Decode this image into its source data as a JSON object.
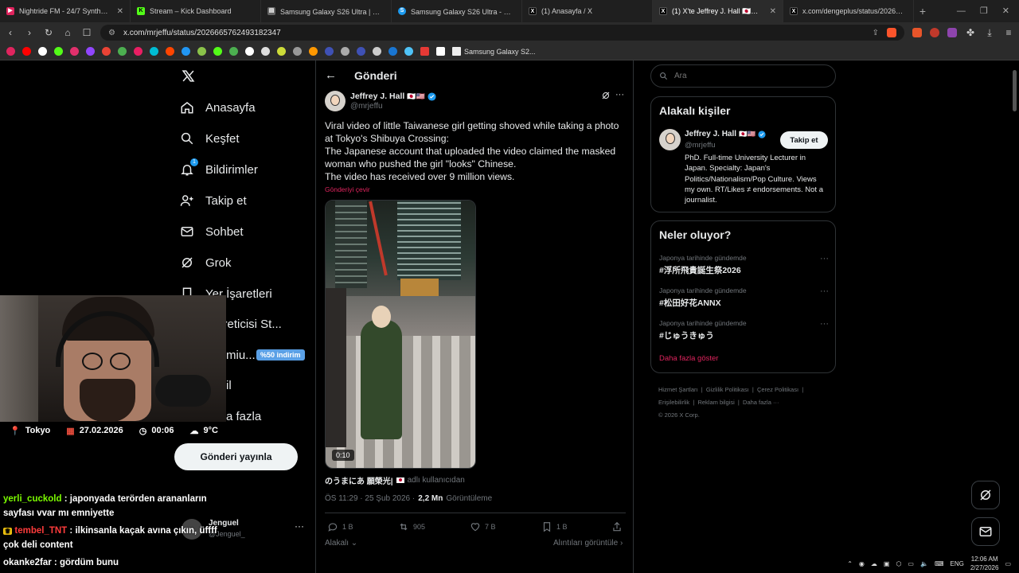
{
  "browser": {
    "tabs": [
      {
        "title": "Nightride FM - 24/7 Synthwave",
        "favicon_color": "#e0245e",
        "favicon_text": "▶"
      },
      {
        "title": "Stream – Kick Dashboard",
        "favicon_color": "#53fc18",
        "favicon_text": "K"
      },
      {
        "title": "Samsung Galaxy S26 Ultra | スマートフ",
        "favicon_color": "#444444",
        "favicon_text": "▤"
      },
      {
        "title": "Samsung Galaxy S26 Ultra - 予約購",
        "favicon_color": "#1d9bf0",
        "favicon_text": "S"
      },
      {
        "title": "(1) Anasayfa / X",
        "favicon_color": "#000000",
        "favicon_text": "X"
      },
      {
        "title": "(1) X'te Jeffrey J. Hall 🇯🇵🇺🇸: \"Viral",
        "favicon_color": "#000000",
        "favicon_text": "X"
      },
      {
        "title": "x.com/dengeplus/status/202663364",
        "favicon_color": "#000000",
        "favicon_text": "X"
      }
    ],
    "url": "x.com/mrjeffu/status/2026665762493182347",
    "bookmark_label": "Samsung Galaxy S2..."
  },
  "nav": {
    "items": [
      {
        "label": "Anasayfa",
        "icon": "home-icon"
      },
      {
        "label": "Keşfet",
        "icon": "search-icon"
      },
      {
        "label": "Bildirimler",
        "icon": "bell-icon",
        "badge": "1"
      },
      {
        "label": "Takip et",
        "icon": "add-person-icon"
      },
      {
        "label": "Sohbet",
        "icon": "mail-icon"
      },
      {
        "label": "Grok",
        "icon": "grok-icon"
      },
      {
        "label": "Yer İşaretleri",
        "icon": "bookmark-icon"
      },
      {
        "label": "k Üreticisi St...",
        "icon": "creator-icon"
      },
      {
        "label": "miu...",
        "icon": "premium-icon"
      },
      {
        "label": "il",
        "icon": "profile-icon"
      },
      {
        "label": "a fazla",
        "icon": "more-icon"
      }
    ],
    "premium_badge": "%50 indirim",
    "post_button": "Gönderi yayınla",
    "account_name": "Jenguel",
    "account_handle": "@Jenguel_"
  },
  "overlay": {
    "location": "Tokyo",
    "date": "27.02.2026",
    "time": "00:06",
    "temperature": "9°C"
  },
  "chat": [
    {
      "user": "yerli_cuckold",
      "user_color": "#7CFC00",
      "line1": "japonyada terörden arananların",
      "line2": "sayfası vvar mı emniyette"
    },
    {
      "user": "tembel_TNT",
      "user_color": "#ff3b3b",
      "line1": "ilkinsanla kaçak avına çıkın, üffff",
      "line2": "çok deli content"
    },
    {
      "user": "okanke2far",
      "user_color": "#ffffff",
      "line1": "gördüm bunu",
      "line2": ""
    }
  ],
  "post": {
    "header": "Gönderi",
    "author_name": "Jeffrey J. Hall",
    "author_flags": "🇯🇵🇺🇸",
    "author_handle": "@mrjeffu",
    "text": [
      "Viral video of little Taiwanese girl getting shoved while taking a photo at Tokyo's Shibuya Crossing:",
      "The Japanese account that uploaded the video claimed the masked woman who pushed the girl \"looks\" Chinese.",
      "The video has received over 9 million views."
    ],
    "translate": "Gönderiyi çevir",
    "video_duration": "0:10",
    "quoted_source": "のうまにあ 願榮光|",
    "quoted_suffix": "adlı kullanıcıdan",
    "timestamp": "ÖS 11:29 · 25 Şub 2026 ·",
    "views_count": "2,2 Mn",
    "views_label": "Görüntüleme",
    "actions": {
      "replies": "1 B",
      "reposts": "905",
      "likes": "7 B",
      "bookmarks": "1 B"
    },
    "related_label": "Alakalı",
    "quotes_label": "Alıntıları görüntüle"
  },
  "sidebar": {
    "search_placeholder": "Ara",
    "related_title": "Alakalı kişiler",
    "person_name": "Jeffrey J. Hall",
    "person_flags": "🇯🇵🇺🇸",
    "person_handle": "@mrjeffu",
    "follow_label": "Takip et",
    "person_bio": "PhD. Full-time University Lecturer in Japan. Specialty: Japan's Politics/Nationalism/Pop Culture. Views my own. RT/Likes ≠ endorsements. Not a journalist.",
    "trends_title": "Neler oluyor?",
    "trends": [
      {
        "category": "Japonya tarihinde gündemde",
        "name": "#浮所飛貴誕生祭2026"
      },
      {
        "category": "Japonya tarihinde gündemde",
        "name": "#松田好花ANNX"
      },
      {
        "category": "Japonya tarihinde gündemde",
        "name": "#じゅうきゅう"
      }
    ],
    "show_more": "Daha fazla göster",
    "footer_links": [
      "Hizmet Şartları",
      "Gizlilik Politikası",
      "Çerez Politikası",
      "Erişilebilirlik",
      "Reklam bilgisi",
      "Daha fazla ···"
    ],
    "copyright": "© 2026 X Corp."
  },
  "taskbar": {
    "language": "ENG",
    "time": "12:06 AM",
    "date": "2/27/2026"
  },
  "colors": {
    "accent": "#1d9bf0",
    "translate": "#e0245e",
    "show_more": "#e0245e"
  }
}
